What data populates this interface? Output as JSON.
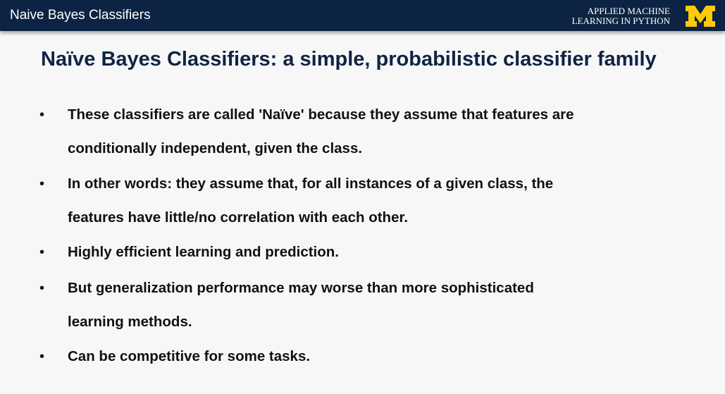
{
  "header": {
    "title": "Naive Bayes Classifiers",
    "course_line1": "APPLIED MACHINE",
    "course_line2": "LEARNING IN PYTHON",
    "logo_icon": "university-m-logo",
    "logo_color": "#ffcb05",
    "background": "#0d2343"
  },
  "slide": {
    "title": "Naïve Bayes Classifiers: a simple, probabilistic classifier family",
    "bullets": [
      {
        "line1": "These classifiers are called 'Naïve' because they assume that features are",
        "line2": "conditionally independent, given the class."
      },
      {
        "line1": "In other words: they assume that, for all instances of a given class, the",
        "line2": "features have little/no correlation with each other."
      },
      {
        "line1": "Highly efficient learning and prediction."
      },
      {
        "line1": "But generalization performance may worse than more sophisticated",
        "line2": "learning methods."
      },
      {
        "line1": "Can be competitive for some tasks."
      }
    ],
    "bullet_symbol": "•"
  }
}
